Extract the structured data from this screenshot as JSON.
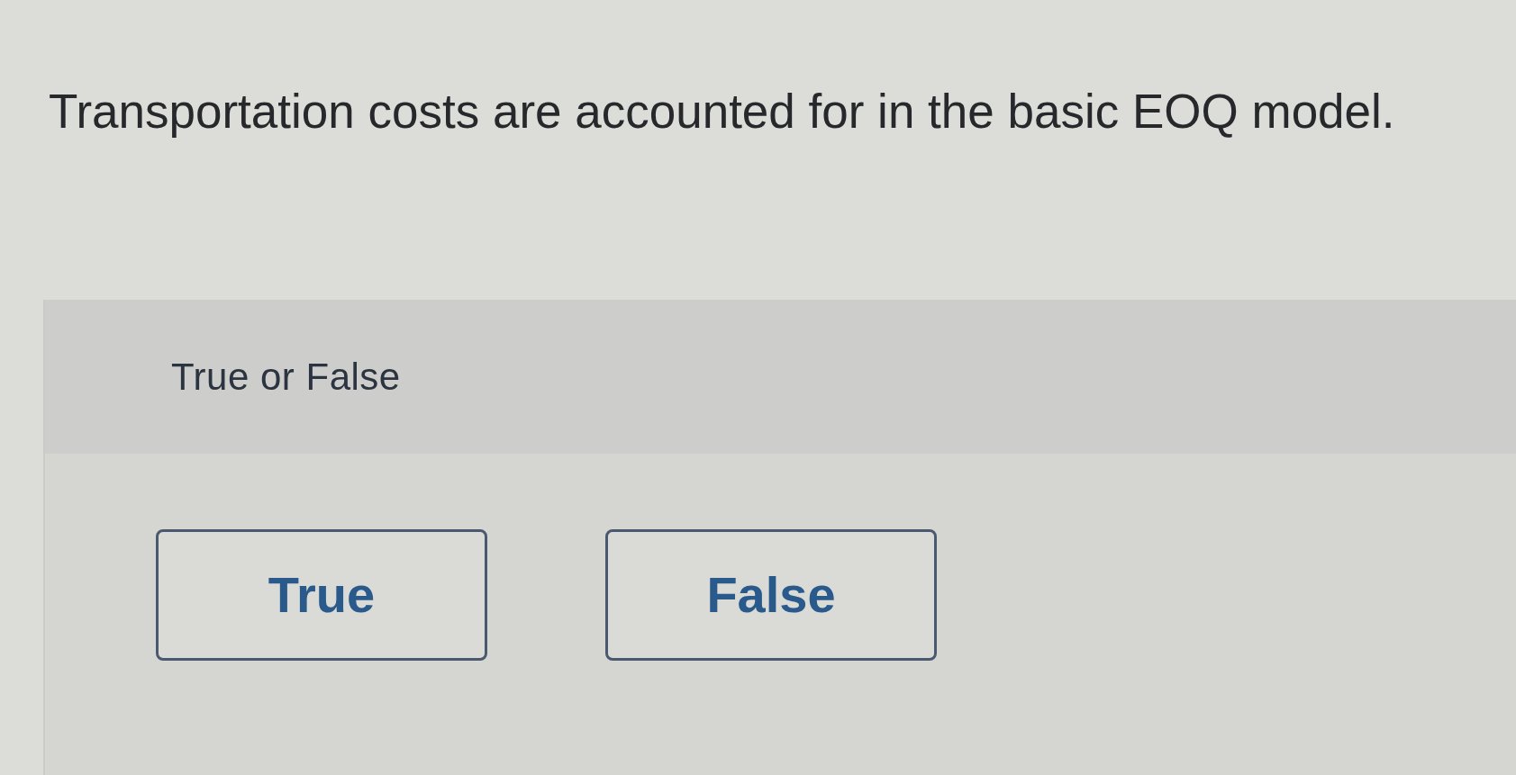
{
  "question": "Transportation costs are accounted for in the basic EOQ model.",
  "prompt": "True or False",
  "answers": [
    {
      "label": "True",
      "selected": false
    },
    {
      "label": "False",
      "selected": false
    }
  ]
}
